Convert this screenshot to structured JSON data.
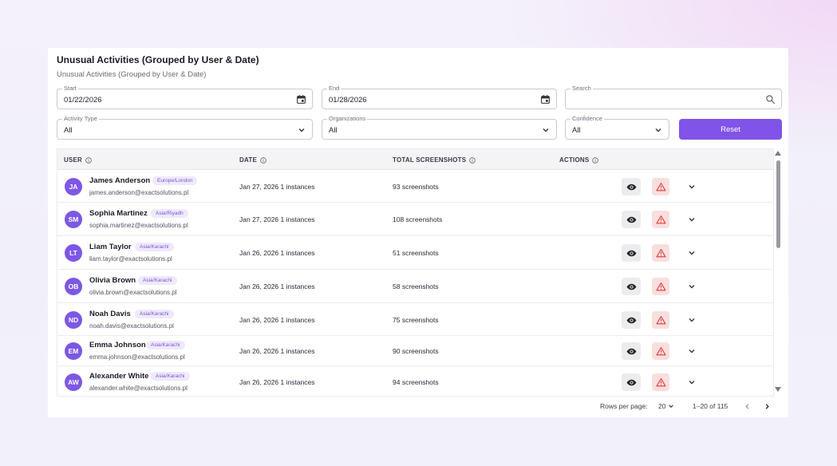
{
  "header": {
    "title": "Unusual Activities (Grouped by User & Date)",
    "subtitle": "Unusual Activities (Grouped by User & Date)"
  },
  "filters": {
    "start": {
      "label": "Start",
      "value": "01/22/2026",
      "icon": "calendar-icon"
    },
    "end": {
      "label": "End",
      "value": "01/28/2026",
      "icon": "calendar-icon"
    },
    "search": {
      "label": "Search",
      "value": "",
      "icon": "search-icon"
    },
    "activity_type": {
      "label": "Activity Type",
      "value": "All"
    },
    "organizations": {
      "label": "Organizations",
      "value": "All"
    },
    "confidence": {
      "label": "Confidence",
      "value": "All"
    },
    "reset_label": "Reset"
  },
  "table": {
    "columns": [
      "USER",
      "DATE",
      "TOTAL SCREENSHOTS",
      "ACTIONS"
    ],
    "rows": [
      {
        "initials": "JA",
        "name": "James Anderson",
        "timezone": "Europe/London",
        "email": "james.anderson@exactsolutions.pl",
        "date": "Jan 27, 2026 1 instances",
        "screenshots": "93 screenshots"
      },
      {
        "initials": "SM",
        "name": "Sophia Martinez",
        "timezone": "Asia/Riyadh",
        "email": "sophia.martinez@exactsolutions.pl",
        "date": "Jan 27, 2026 1 instances",
        "screenshots": "108 screenshots"
      },
      {
        "initials": "LT",
        "name": "Liam Taylor",
        "timezone": "Asia/Karachi",
        "email": "liam.taylor@exactsolutions.pl",
        "date": "Jan 26, 2026 1 instances",
        "screenshots": "51 screenshots"
      },
      {
        "initials": "OB",
        "name": "Olivia Brown",
        "timezone": "Asia/Karachi",
        "email": "olivia.brown@exactsolutions.pl",
        "date": "Jan 26, 2026 1 instances",
        "screenshots": "58 screenshots"
      },
      {
        "initials": "ND",
        "name": "Noah Davis",
        "timezone": "Asia/Karachi",
        "email": "noah.davis@exactsolutions.pl",
        "date": "Jan 26, 2026 1 instances",
        "screenshots": "75 screenshots"
      },
      {
        "initials": "EM",
        "name": "Emma Johnson",
        "timezone": "Asia/Karachi",
        "email": "emma.johnson@exactsolutions.pl",
        "date": "Jan 26, 2026 1 instances",
        "screenshots": "90 screenshots"
      },
      {
        "initials": "AW",
        "name": "Alexander White",
        "timezone": "Asia/Karachi",
        "email": "alexander.white@exactsolutions.pl",
        "date": "Jan 26, 2026 1 instances",
        "screenshots": "94 screenshots"
      }
    ]
  },
  "pagination": {
    "rows_per_page_label": "Rows per page:",
    "rows_per_page": "20",
    "range": "1–20 of 115"
  },
  "colors": {
    "accent": "#8054e8",
    "avatar": "#7d57e5",
    "warn_bg": "#f9dede",
    "warn_icon": "#d93a3a"
  }
}
